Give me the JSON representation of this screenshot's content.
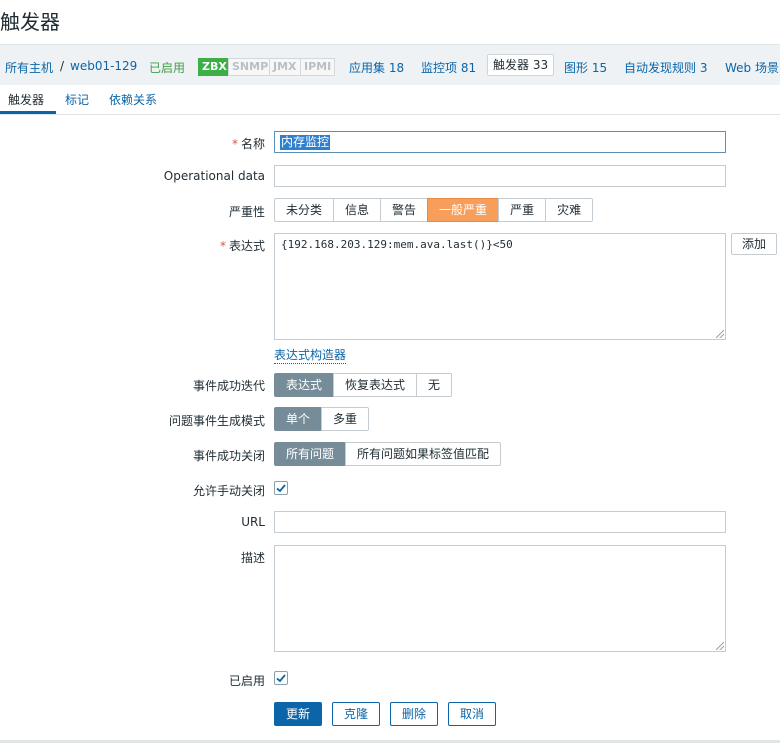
{
  "page": {
    "title": "触发器"
  },
  "host_nav": {
    "all_hosts": "所有主机",
    "separator": "/",
    "host_name": "web01-129",
    "status": "已启用",
    "badges": [
      "ZBX",
      "SNMP",
      "JMX",
      "IPMI"
    ],
    "applications": "应用集 18",
    "items": "监控项 81",
    "triggers": "触发器 33",
    "graphs": "图形 15",
    "discovery": "自动发现规则 3",
    "web": "Web 场景"
  },
  "subtabs": [
    "触发器",
    "标记",
    "依赖关系"
  ],
  "form": {
    "name_label": "名称",
    "name_value": "内存监控",
    "opdata_label": "Operational data",
    "opdata_value": "",
    "severity_label": "严重性",
    "severity_options": [
      "未分类",
      "信息",
      "警告",
      "一般严重",
      "严重",
      "灾难"
    ],
    "severity_selected": "一般严重",
    "expression_label": "表达式",
    "expression_value": "{192.168.203.129:mem.ava.last()}<50",
    "add_button": "添加",
    "expression_builder": "表达式构造器",
    "ok_event_label": "事件成功迭代",
    "ok_event_options": [
      "表达式",
      "恢复表达式",
      "无"
    ],
    "ok_event_selected": "表达式",
    "problem_mode_label": "问题事件生成模式",
    "problem_mode_options": [
      "单个",
      "多重"
    ],
    "problem_mode_selected": "单个",
    "ok_close_label": "事件成功关闭",
    "ok_close_options": [
      "所有问题",
      "所有问题如果标签值匹配"
    ],
    "ok_close_selected": "所有问题",
    "manual_close_label": "允许手动关闭",
    "manual_close_checked": true,
    "url_label": "URL",
    "url_value": "",
    "description_label": "描述",
    "description_value": "",
    "enabled_label": "已启用",
    "enabled_checked": true
  },
  "actions": {
    "update": "更新",
    "clone": "克隆",
    "delete": "删除",
    "cancel": "取消"
  },
  "colors": {
    "link": "#0b65a8",
    "accent_orange": "#f79e5a",
    "selected_gray": "#768d99",
    "enabled_green": "#429e47"
  }
}
